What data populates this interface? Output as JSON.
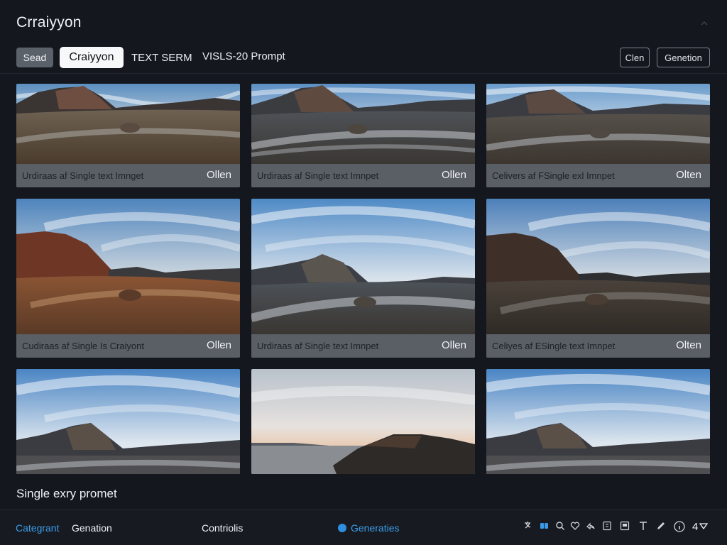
{
  "app": {
    "title": "Crraiyyon"
  },
  "toolbar": {
    "seed_label": "Sead",
    "brand_button_label": "Craiyyon",
    "tab_serm": "TEXT SERM",
    "tab_prompt": "VISLS-20 Prompt",
    "clen_label": "Clen",
    "genetion_label": "Genetion"
  },
  "gallery": {
    "cards": [
      {
        "caption": "Urdiraas af Single text Imnget",
        "action": "Ollen",
        "scene": "earth"
      },
      {
        "caption": "Urdiraas af Single text Imnpet",
        "action": "Ollen",
        "scene": "frost"
      },
      {
        "caption": "Celivers af FSingle exl Imnpet",
        "action": "Olten",
        "scene": "frost"
      },
      {
        "caption": "Cudiraas af Single Is Craiyont",
        "action": "Ollen",
        "scene": "red"
      },
      {
        "caption": "Urdiraas af Single text Imnpet",
        "action": "Ollen",
        "scene": "frost"
      },
      {
        "caption": "Celiyes af ESingle text Imnpet",
        "action": "Olten",
        "scene": "dusk"
      },
      {
        "caption": "",
        "action": "",
        "scene": "sky"
      },
      {
        "caption": "",
        "action": "",
        "scene": "sunset"
      },
      {
        "caption": "",
        "action": "",
        "scene": "sky"
      }
    ]
  },
  "prompt": {
    "label": "Single exry promet"
  },
  "bottom_nav": {
    "categrant": "Categrant",
    "genation": "Genation",
    "controls": "Contriolis",
    "generaties": "Generaties",
    "page_number": "4"
  },
  "icons": [
    "translate-icon",
    "layers-icon",
    "search-icon",
    "heart-icon",
    "share-icon",
    "book-icon",
    "gallery-icon",
    "text-icon",
    "pencil-icon",
    "info-icon"
  ],
  "colors": {
    "accent": "#3b9be8",
    "background": "#14181e",
    "caption_bar": "#5a5e65"
  }
}
